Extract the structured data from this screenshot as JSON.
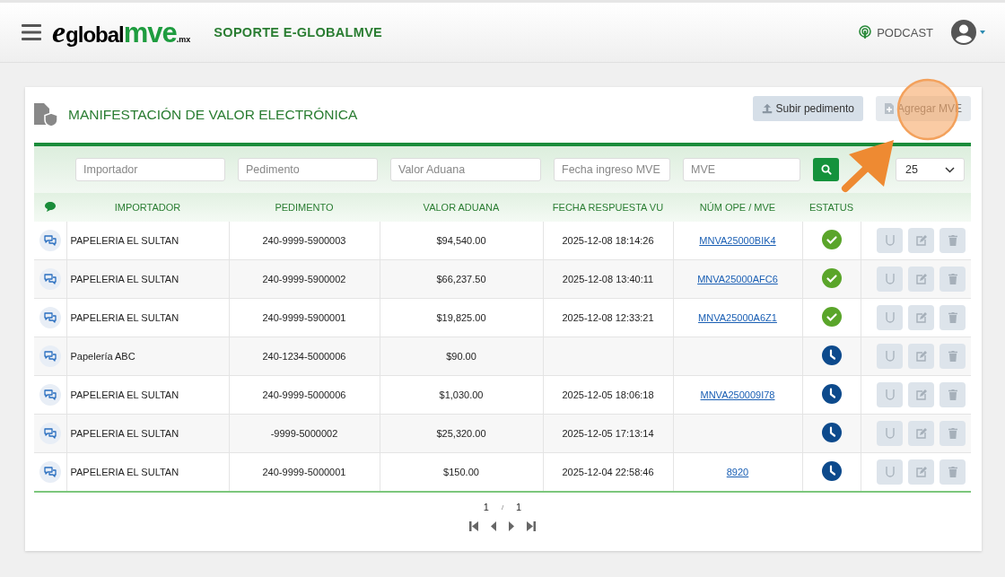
{
  "header": {
    "logo": {
      "prefix": "e",
      "main": "global",
      "accent": "mve",
      "suffix": ".mx"
    },
    "title": "SOPORTE E-GLOBALMVE",
    "podcast": "PODCAST"
  },
  "panel": {
    "title": "MANIFESTACIÓN DE VALOR ELECTRÓNICA",
    "buttons": [
      {
        "label": "Subir pedimento",
        "kind": "upload"
      },
      {
        "label": "Agregar MVE",
        "kind": "add"
      }
    ],
    "filters": [
      {
        "placeholder": "Importador"
      },
      {
        "placeholder": "Pedimento"
      },
      {
        "placeholder": "Valor Aduana"
      },
      {
        "placeholder": "Fecha ingreso MVE"
      },
      {
        "placeholder": "MVE"
      }
    ],
    "page_size": "25",
    "table": {
      "columns": [
        "IMPORTADOR",
        "PEDIMENTO",
        "VALOR ADUANA",
        "FECHA RESPUESTA VU",
        "NÚM OPE / MVE",
        "ESTATUS"
      ],
      "actions_disabled": true,
      "rows": [
        {
          "importador": "PAPELERIA EL SULTAN",
          "pedimento": "240-9999-5900003",
          "valor": "$94,540.00",
          "fecha": "2025-12-08 18:14:26",
          "num": "MNVA25000BIK4",
          "kind": "done"
        },
        {
          "importador": "PAPELERIA EL SULTAN",
          "pedimento": "240-9999-5900002",
          "valor": "$66,237.50",
          "fecha": "2025-12-08 13:40:11",
          "num": "MNVA25000AFC6",
          "kind": "done"
        },
        {
          "importador": "PAPELERIA EL SULTAN",
          "pedimento": "240-9999-5900001",
          "valor": "$19,825.00",
          "fecha": "2025-12-08 12:33:21",
          "num": "MNVA25000A6Z1",
          "kind": "done"
        },
        {
          "importador": "Papelería ABC",
          "pedimento": "240-1234-5000006",
          "valor": "$90.00",
          "kind": "pending"
        },
        {
          "importador": "PAPELERIA EL SULTAN",
          "pedimento": "240-9999-5000006",
          "valor": "$1,030.00",
          "fecha": "2025-12-05 18:06:18",
          "num": "MNVA250009I78",
          "kind": "pending"
        },
        {
          "importador": "PAPELERIA EL SULTAN",
          "pedimento": "-9999-5000002",
          "valor": "$25,320.00",
          "fecha": "2025-12-05 17:13:14",
          "kind": "pending"
        },
        {
          "importador": "PAPELERIA EL SULTAN",
          "pedimento": "240-9999-5000001",
          "valor": "$150.00",
          "fecha": "2025-12-04 22:58:46",
          "num": "8920",
          "kind": "pending"
        }
      ]
    },
    "pagination": {
      "current": "1",
      "separator": "/",
      "total": "1"
    }
  },
  "annotation": {
    "kind": "arrow_circle"
  }
}
